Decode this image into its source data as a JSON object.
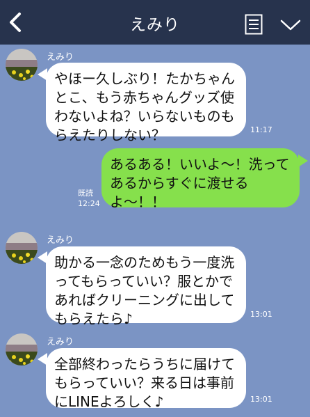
{
  "header": {
    "title": "えみり"
  },
  "messages": [
    {
      "sender": "えみり",
      "text": "やほー久しぶり！たかちゃんとこ、もう赤ちゃんグッズ使わないよね？いらないものもらえたりしない？",
      "time": "11:17"
    },
    {
      "sender": "me",
      "text": "あるある！いいよ〜！洗ってあるからすぐに渡せるよ〜！！",
      "read": "既読",
      "time": "12:24"
    },
    {
      "sender": "えみり",
      "text": "助かる一念のためもう一度洗ってもらっていい？服とかであればクリーニングに出してもらえたら♪",
      "time": "13:01"
    },
    {
      "sender": "えみり",
      "text": "全部終わったらうちに届けてもらっていい？来る日は事前にLINEよろしく♪",
      "time": "13:01"
    }
  ],
  "colors": {
    "background": "#7b94c4",
    "header": "#27334d",
    "incoming": "#ffffff",
    "outgoing": "#86e04c"
  },
  "icons": [
    "back-chevron-icon",
    "memo-icon",
    "chevron-down-icon"
  ]
}
